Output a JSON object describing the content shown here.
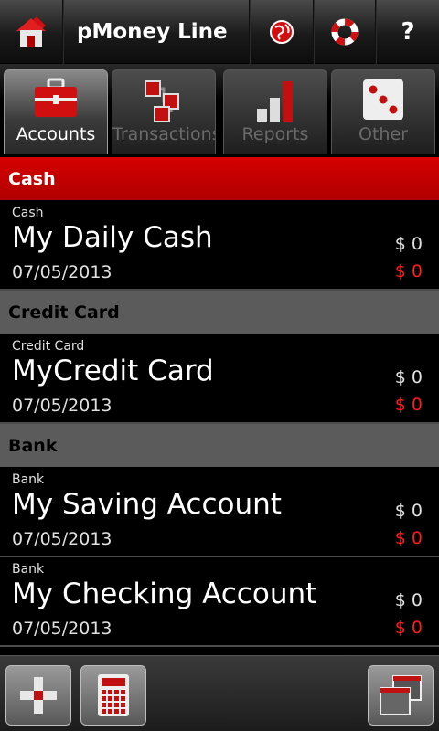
{
  "app": {
    "title": "pMoney Line"
  },
  "header_icons": [
    "home-icon",
    "globe-icon",
    "lifebuoy-icon",
    "help-icon"
  ],
  "help_glyph": "?",
  "tabs": [
    {
      "label": "Accounts",
      "icon": "briefcase-icon",
      "active": true
    },
    {
      "label": "Transactions",
      "icon": "transactions-icon",
      "active": false
    },
    {
      "label": "Reports",
      "icon": "bar-chart-icon",
      "active": false
    },
    {
      "label": "Other",
      "icon": "dice-icon",
      "active": false
    }
  ],
  "sections": [
    {
      "title": "Cash",
      "style": "red",
      "accounts": [
        {
          "type": "Cash",
          "name": "My Daily Cash",
          "date": "07/05/2013",
          "balance": "$ 0",
          "balance_alt": "$ 0"
        }
      ]
    },
    {
      "title": "Credit Card",
      "style": "gray",
      "accounts": [
        {
          "type": "Credit Card",
          "name": "MyCredit Card",
          "date": "07/05/2013",
          "balance": "$ 0",
          "balance_alt": "$ 0"
        }
      ]
    },
    {
      "title": "Bank",
      "style": "gray",
      "accounts": [
        {
          "type": "Bank",
          "name": "My Saving Account",
          "date": "07/05/2013",
          "balance": "$ 0",
          "balance_alt": "$ 0"
        },
        {
          "type": "Bank",
          "name": "My Checking Account",
          "date": "07/05/2013",
          "balance": "$ 0",
          "balance_alt": "$ 0"
        }
      ]
    }
  ],
  "bottom_buttons": [
    "add-icon",
    "calculator-icon",
    "window-switch-icon"
  ],
  "colors": {
    "accent_red": "#cc0000",
    "negative_balance": "#ff1a1a"
  }
}
